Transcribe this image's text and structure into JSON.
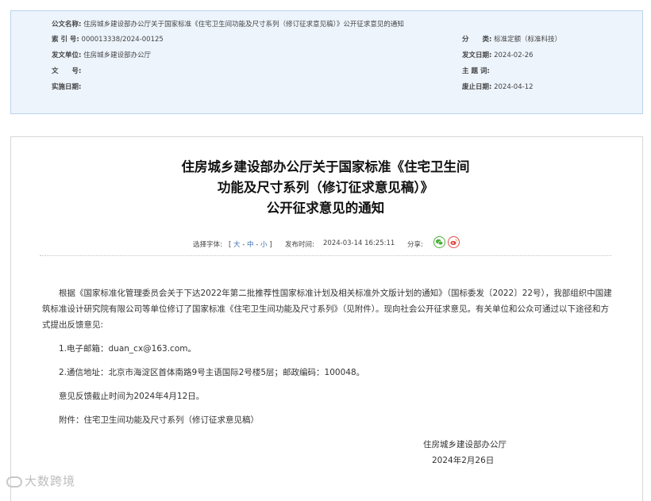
{
  "meta": {
    "title_label": "公文名称:",
    "title_value": "住房城乡建设部办公厅关于国家标准《住宅卫生间功能及尺寸系列（修订征求意见稿）》公开征求意见的通知",
    "index_label": "索 引 号:",
    "index_value": "000013338/2024-00125",
    "category_label": "分　　类:",
    "category_value": "标准定额（标准科技）",
    "issuer_label": "发文单位:",
    "issuer_value": "住房城乡建设部办公厅",
    "date_label": "发文日期:",
    "date_value": "2024-02-26",
    "docno_label": "文　　号:",
    "docno_value": "",
    "subject_label": "主 题 词:",
    "subject_value": "",
    "effective_label": "实施日期:",
    "effective_value": "",
    "repeal_label": "废止日期:",
    "repeal_value": "2024-04-12"
  },
  "article": {
    "title_line1": "住房城乡建设部办公厅关于国家标准《住宅卫生间",
    "title_line2": "功能及尺寸系列（修订征求意见稿）》",
    "title_line3": "公开征求意见的通知",
    "font_label": "选择字体:",
    "font_open": "[",
    "font_large": "大",
    "font_sep1": "-",
    "font_medium": "中",
    "font_sep2": "-",
    "font_small": "小",
    "font_close": "]",
    "publish_label": "发布时间:",
    "publish_time": "2024-03-14 16:25:11",
    "share_label": "分享:",
    "para1": "根据《国家标准化管理委员会关于下达2022年第二批推荐性国家标准计划及相关标准外文版计划的通知》（国标委发〔2022〕22号），我部组织中国建筑标准设计研究院有限公司等单位修订了国家标准《住宅卫生间功能及尺寸系列》（见附件）。现向社会公开征求意见。有关单位和公众可通过以下途径和方式提出反馈意见:",
    "para2": "1.电子邮箱：duan_cx@163.com。",
    "para3": "2.通信地址：北京市海淀区首体南路9号主语国际2号楼5层；邮政编码：100048。",
    "para4": "意见反馈截止时间为2024年4月12日。",
    "para5": "附件：住宅卫生间功能及尺寸系列（修订征求意见稿）",
    "signature": "住房城乡建设部办公厅",
    "sign_date": "2024年2月26日"
  },
  "watermark": "大数跨境",
  "icons": {
    "share1": "wechat-icon",
    "share2": "weibo-icon"
  },
  "colors": {
    "meta_bg": "#edf4fc",
    "meta_border": "#b9d3ec",
    "link": "#3a6db3",
    "wechat": "#4bb03a",
    "weibo": "#e24a4a"
  }
}
